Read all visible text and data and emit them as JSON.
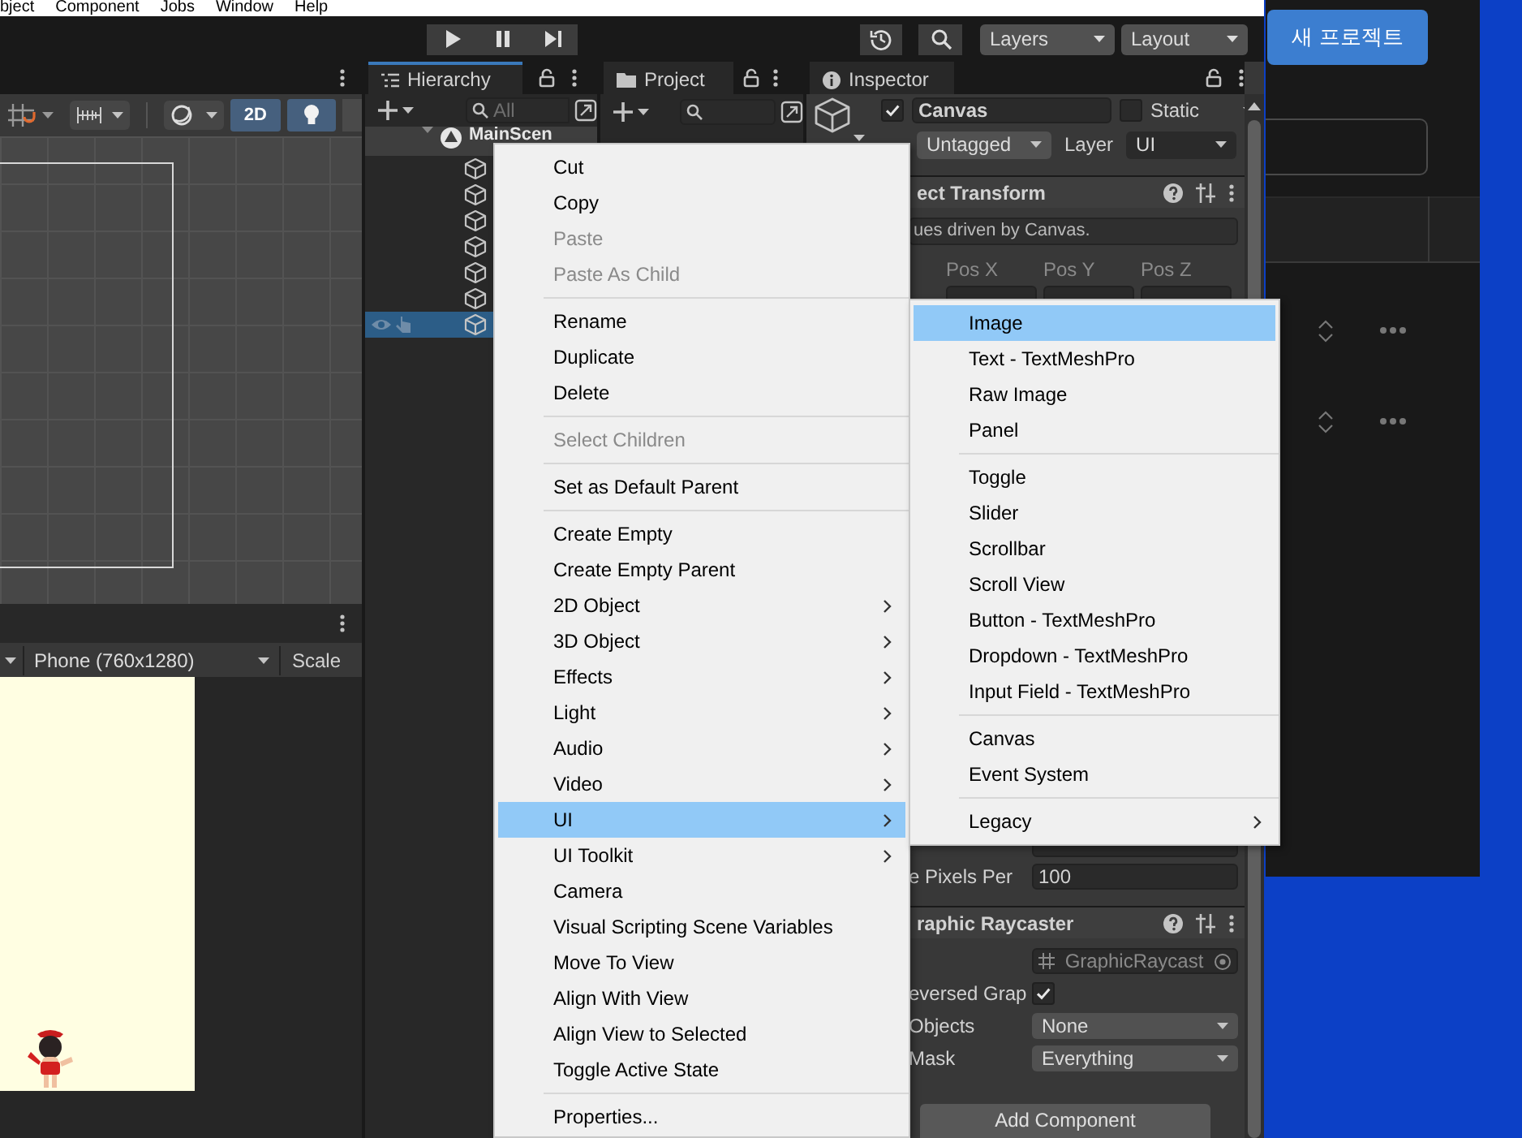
{
  "menu_bar": {
    "items": [
      "bject",
      "Component",
      "Jobs",
      "Window",
      "Help"
    ]
  },
  "toolbar": {
    "layers": "Layers",
    "layout": "Layout"
  },
  "scene_view": {
    "toggles": [
      {
        "kind": "text",
        "label": "2D",
        "selected": true
      },
      {
        "kind": "light",
        "selected": true
      }
    ]
  },
  "game_view": {
    "resolution": "Phone (760x1280)",
    "scale": "Scale"
  },
  "hierarchy": {
    "title": "Hierarchy",
    "search_placeholder": "All",
    "scene": "MainScen",
    "objects": [
      {
        "selected": false
      },
      {
        "selected": false
      },
      {
        "selected": false
      },
      {
        "selected": false
      },
      {
        "selected": false
      },
      {
        "selected": false
      },
      {
        "selected": true
      }
    ]
  },
  "project": {
    "title": "Project"
  },
  "inspector": {
    "title": "Inspector",
    "active": true,
    "name": "Canvas",
    "static": false,
    "static_label": "Static",
    "tag": "Untagged",
    "layer_label": "Layer",
    "layer": "UI",
    "rect_transform": {
      "title": "ect Transform",
      "note": "ues driven by Canvas.",
      "fields": [
        {
          "label": "Pos X"
        },
        {
          "label": "Pos Y"
        },
        {
          "label": "Pos Z"
        }
      ]
    },
    "canvas_rows": [
      {
        "label": "e Pixels Per",
        "value": "100"
      }
    ],
    "graphic_raycaster": {
      "title": "raphic Raycaster",
      "script": "GraphicRaycast",
      "rows": [
        {
          "kind": "checkbox",
          "label": "eversed Grap",
          "checked": true
        },
        {
          "kind": "dropdown",
          "label": "Objects",
          "value": "None"
        },
        {
          "kind": "dropdown",
          "label": "Mask",
          "value": "Everything"
        }
      ]
    },
    "add_component": "Add Component"
  },
  "context_menu": {
    "groups": [
      [
        {
          "label": "Cut",
          "disabled": false,
          "has_submenu": false,
          "selected": false
        },
        {
          "label": "Copy",
          "disabled": false,
          "has_submenu": false,
          "selected": false
        },
        {
          "label": "Paste",
          "disabled": true,
          "has_submenu": false,
          "selected": false
        },
        {
          "label": "Paste As Child",
          "disabled": true,
          "has_submenu": false,
          "selected": false
        }
      ],
      [
        {
          "label": "Rename",
          "disabled": false,
          "has_submenu": false,
          "selected": false
        },
        {
          "label": "Duplicate",
          "disabled": false,
          "has_submenu": false,
          "selected": false
        },
        {
          "label": "Delete",
          "disabled": false,
          "has_submenu": false,
          "selected": false
        }
      ],
      [
        {
          "label": "Select Children",
          "disabled": true,
          "has_submenu": false,
          "selected": false
        }
      ],
      [
        {
          "label": "Set as Default Parent",
          "disabled": false,
          "has_submenu": false,
          "selected": false
        }
      ],
      [
        {
          "label": "Create Empty",
          "disabled": false,
          "has_submenu": false,
          "selected": false
        },
        {
          "label": "Create Empty Parent",
          "disabled": false,
          "has_submenu": false,
          "selected": false
        },
        {
          "label": "2D Object",
          "disabled": false,
          "has_submenu": true,
          "selected": false
        },
        {
          "label": "3D Object",
          "disabled": false,
          "has_submenu": true,
          "selected": false
        },
        {
          "label": "Effects",
          "disabled": false,
          "has_submenu": true,
          "selected": false
        },
        {
          "label": "Light",
          "disabled": false,
          "has_submenu": true,
          "selected": false
        },
        {
          "label": "Audio",
          "disabled": false,
          "has_submenu": true,
          "selected": false
        },
        {
          "label": "Video",
          "disabled": false,
          "has_submenu": true,
          "selected": false
        },
        {
          "label": "UI",
          "disabled": false,
          "has_submenu": true,
          "selected": true
        },
        {
          "label": "UI Toolkit",
          "disabled": false,
          "has_submenu": true,
          "selected": false
        },
        {
          "label": "Camera",
          "disabled": false,
          "has_submenu": false,
          "selected": false
        },
        {
          "label": "Visual Scripting Scene Variables",
          "disabled": false,
          "has_submenu": false,
          "selected": false
        },
        {
          "label": "Move To View",
          "disabled": false,
          "has_submenu": false,
          "selected": false
        },
        {
          "label": "Align With View",
          "disabled": false,
          "has_submenu": false,
          "selected": false
        },
        {
          "label": "Align View to Selected",
          "disabled": false,
          "has_submenu": false,
          "selected": false
        },
        {
          "label": "Toggle Active State",
          "disabled": false,
          "has_submenu": false,
          "selected": false
        }
      ],
      [
        {
          "label": "Properties...",
          "disabled": false,
          "has_submenu": false,
          "selected": false
        }
      ]
    ]
  },
  "submenu": {
    "groups": [
      [
        {
          "label": "Image",
          "disabled": false,
          "has_submenu": false,
          "selected": true
        },
        {
          "label": "Text - TextMeshPro",
          "disabled": false,
          "has_submenu": false,
          "selected": false
        },
        {
          "label": "Raw Image",
          "disabled": false,
          "has_submenu": false,
          "selected": false
        },
        {
          "label": "Panel",
          "disabled": false,
          "has_submenu": false,
          "selected": false
        }
      ],
      [
        {
          "label": "Toggle",
          "disabled": false,
          "has_submenu": false,
          "selected": false
        },
        {
          "label": "Slider",
          "disabled": false,
          "has_submenu": false,
          "selected": false
        },
        {
          "label": "Scrollbar",
          "disabled": false,
          "has_submenu": false,
          "selected": false
        },
        {
          "label": "Scroll View",
          "disabled": false,
          "has_submenu": false,
          "selected": false
        },
        {
          "label": "Button - TextMeshPro",
          "disabled": false,
          "has_submenu": false,
          "selected": false
        },
        {
          "label": "Dropdown - TextMeshPro",
          "disabled": false,
          "has_submenu": false,
          "selected": false
        },
        {
          "label": "Input Field - TextMeshPro",
          "disabled": false,
          "has_submenu": false,
          "selected": false
        }
      ],
      [
        {
          "label": "Canvas",
          "disabled": false,
          "has_submenu": false,
          "selected": false
        },
        {
          "label": "Event System",
          "disabled": false,
          "has_submenu": false,
          "selected": false
        }
      ],
      [
        {
          "label": "Legacy",
          "disabled": false,
          "has_submenu": true,
          "selected": false
        }
      ]
    ]
  },
  "hub": {
    "new_project": "새 프로젝트"
  }
}
